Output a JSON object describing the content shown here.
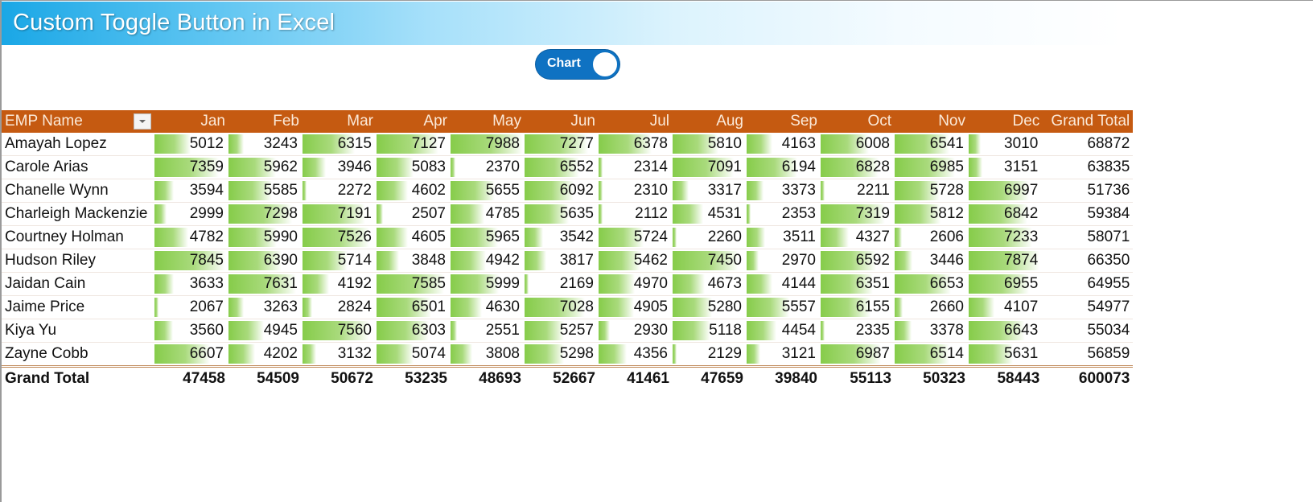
{
  "banner": {
    "title": "Custom Toggle Button in Excel"
  },
  "toggle": {
    "label": "Chart",
    "state": "on"
  },
  "colors": {
    "banner": "#1aa7e6",
    "header": "#c55a11",
    "bar": "#86cc4a",
    "toggle": "#0f72c2"
  },
  "table": {
    "row_header": "EMP Name",
    "months": [
      "Jan",
      "Feb",
      "Mar",
      "Apr",
      "May",
      "Jun",
      "Jul",
      "Aug",
      "Sep",
      "Oct",
      "Nov",
      "Dec"
    ],
    "grand_total_header": "Grand Total",
    "rows": [
      {
        "name": "Amayah Lopez",
        "values": [
          5012,
          3243,
          6315,
          7127,
          7988,
          7277,
          6378,
          5810,
          4163,
          6008,
          6541,
          3010
        ],
        "total": 68872
      },
      {
        "name": "Carole Arias",
        "values": [
          7359,
          5962,
          3946,
          5083,
          2370,
          6552,
          2314,
          7091,
          6194,
          6828,
          6985,
          3151
        ],
        "total": 63835
      },
      {
        "name": "Chanelle Wynn",
        "values": [
          3594,
          5585,
          2272,
          4602,
          5655,
          6092,
          2310,
          3317,
          3373,
          2211,
          5728,
          6997
        ],
        "total": 51736
      },
      {
        "name": "Charleigh Mackenzie",
        "values": [
          2999,
          7298,
          7191,
          2507,
          4785,
          5635,
          2112,
          4531,
          2353,
          7319,
          5812,
          6842
        ],
        "total": 59384
      },
      {
        "name": "Courtney Holman",
        "values": [
          4782,
          5990,
          7526,
          4605,
          5965,
          3542,
          5724,
          2260,
          3511,
          4327,
          2606,
          7233
        ],
        "total": 58071
      },
      {
        "name": "Hudson Riley",
        "values": [
          7845,
          6390,
          5714,
          3848,
          4942,
          3817,
          5462,
          7450,
          2970,
          6592,
          3446,
          7874
        ],
        "total": 66350
      },
      {
        "name": "Jaidan Cain",
        "values": [
          3633,
          7631,
          4192,
          7585,
          5999,
          2169,
          4970,
          4673,
          4144,
          6351,
          6653,
          6955
        ],
        "total": 64955
      },
      {
        "name": "Jaime Price",
        "values": [
          2067,
          3263,
          2824,
          6501,
          4630,
          7028,
          4905,
          5280,
          5557,
          6155,
          2660,
          4107
        ],
        "total": 54977
      },
      {
        "name": "Kiya Yu",
        "values": [
          3560,
          4945,
          7560,
          6303,
          2551,
          5257,
          2930,
          5118,
          4454,
          2335,
          3378,
          6643
        ],
        "total": 55034
      },
      {
        "name": "Zayne Cobb",
        "values": [
          6607,
          4202,
          3132,
          5074,
          3808,
          5298,
          4356,
          2129,
          3121,
          6987,
          6514,
          5631
        ],
        "total": 56859
      }
    ],
    "grand_total": {
      "label": "Grand Total",
      "values": [
        47458,
        54509,
        50672,
        53235,
        48693,
        52667,
        41461,
        47659,
        39840,
        55113,
        50323,
        58443
      ],
      "total": 600073
    },
    "databar_min": 2000,
    "databar_max": 8000
  }
}
